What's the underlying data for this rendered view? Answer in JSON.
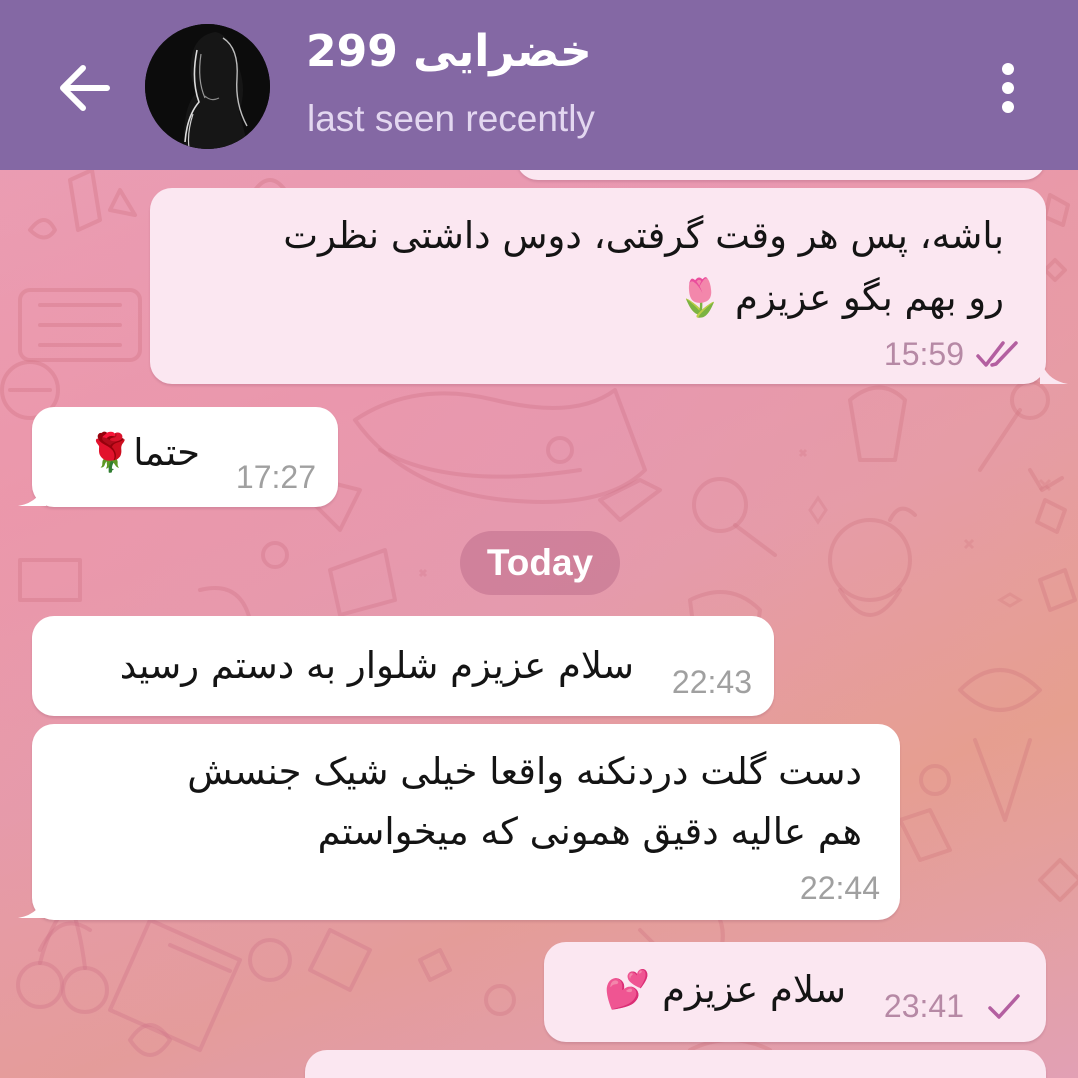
{
  "header": {
    "title": "خضرایی 299",
    "status": "last seen recently"
  },
  "messages": [
    {
      "text_line1": "باشه، پس هر وقت گرفتی، دوس داشتی نظرت",
      "text_line2": "رو بهم بگو عزیزم 🌷",
      "time": "15:59",
      "direction": "outgoing",
      "read": true
    },
    {
      "text": "حتما🌹",
      "time": "17:27",
      "direction": "incoming"
    },
    {
      "text": "سلام عزیزم شلوار به دستم رسید",
      "time": "22:43",
      "direction": "incoming"
    },
    {
      "text_line1": "دست گلت دردنکنه واقعا خیلی شیک جنسش",
      "text_line2": "هم عالیه دقیق همونی که میخواستم",
      "time": "22:44",
      "direction": "incoming"
    },
    {
      "text": "سلام عزیزم 💕",
      "time": "23:41",
      "direction": "outgoing",
      "read": false
    }
  ],
  "date_separator": "Today",
  "icons": {
    "back": "arrow-left-icon",
    "menu": "kebab-menu-icon",
    "read_receipt": "double-check-icon",
    "sent_receipt": "single-check-icon"
  },
  "colors": {
    "header_bg": "#8468a4",
    "outgoing_bubble": "#fbe7f1",
    "incoming_bubble": "#ffffff",
    "check_color": "#b35fa0"
  }
}
